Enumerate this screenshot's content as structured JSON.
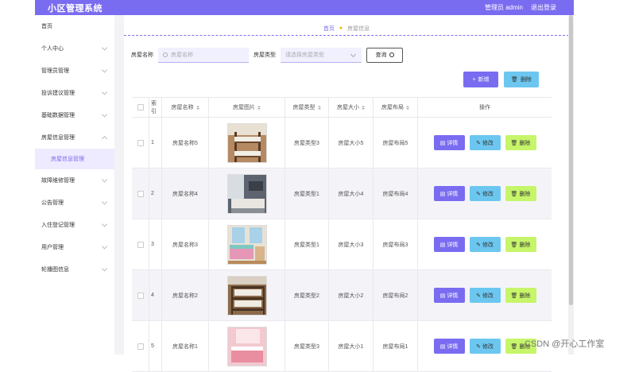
{
  "header": {
    "title": "小区管理系统",
    "user_label": "管理员 admin",
    "logout_label": "退出登录",
    "brand_color": "#7a6cf0"
  },
  "sidebar": {
    "items": [
      {
        "label": "首页",
        "has_chevron": false
      },
      {
        "label": "个人中心",
        "has_chevron": true
      },
      {
        "label": "管理员管理",
        "has_chevron": true
      },
      {
        "label": "投诉建议管理",
        "has_chevron": true
      },
      {
        "label": "基础数据管理",
        "has_chevron": true
      },
      {
        "label": "房屋信息管理",
        "has_chevron": true,
        "expanded": true
      },
      {
        "label": "房屋信息管理",
        "sub": true,
        "active": true
      },
      {
        "label": "故障维修管理",
        "has_chevron": true
      },
      {
        "label": "公告管理",
        "has_chevron": true
      },
      {
        "label": "入住登记管理",
        "has_chevron": true
      },
      {
        "label": "用户管理",
        "has_chevron": true
      },
      {
        "label": "轮播图信息",
        "has_chevron": true
      }
    ]
  },
  "breadcrumb": {
    "home": "首页",
    "current": "房屋信息"
  },
  "search": {
    "name_label": "房屋名称",
    "name_placeholder": "房屋名称",
    "type_label": "房屋类型",
    "type_placeholder": "请选择房屋类型",
    "query_label": "查询"
  },
  "toolbar": {
    "add_label": "新增",
    "delete_label": "删除"
  },
  "table": {
    "headers": {
      "index": "索引",
      "name": "房屋名称",
      "image": "房屋图片",
      "type": "房屋类型",
      "size": "房屋大小",
      "layout": "房屋布局",
      "op": "操作"
    },
    "rows": [
      {
        "index": "1",
        "name": "房屋名称5",
        "type": "房屋类型3",
        "size": "房屋大小5",
        "layout": "房屋布局5",
        "thumb_icon": "bunk-bed-room-photo"
      },
      {
        "index": "2",
        "name": "房屋名称4",
        "type": "房屋类型1",
        "size": "房屋大小4",
        "layout": "房屋布局4",
        "thumb_icon": "bedroom-photo"
      },
      {
        "index": "3",
        "name": "房屋名称3",
        "type": "房屋类型1",
        "size": "房屋大小3",
        "layout": "房屋布局3",
        "thumb_icon": "kids-bedroom-photo"
      },
      {
        "index": "4",
        "name": "房屋名称2",
        "type": "房屋类型2",
        "size": "房屋大小2",
        "layout": "房屋布局2",
        "thumb_icon": "dorm-room-photo"
      },
      {
        "index": "5",
        "name": "房屋名称1",
        "type": "房屋类型3",
        "size": "房屋大小1",
        "layout": "房屋布局1",
        "thumb_icon": "pink-bedroom-photo"
      }
    ],
    "op_detail": "详情",
    "op_edit": "修改",
    "op_delete": "删除"
  },
  "watermark": "CSDN @开心工作室"
}
